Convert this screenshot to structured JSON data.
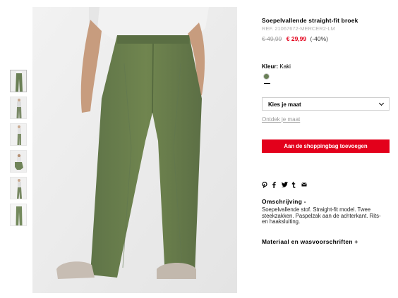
{
  "product": {
    "title": "Soepelvallende straight-fit broek",
    "ref": "REF. 21067672-MERCER2-LM",
    "old_price": "€ 49,99",
    "new_price": "€ 29,99",
    "discount": "(-40%)"
  },
  "color": {
    "label": "Kleur:",
    "value": "Kaki",
    "swatch_color": "#6a8057"
  },
  "size": {
    "select_label": "Kies je maat",
    "link": "Ontdek je maat"
  },
  "cta": {
    "add_to_bag": "Aan de shoppingbag toevoegen",
    "color": "#e3001b"
  },
  "share_icons": [
    "pinterest-icon",
    "facebook-icon",
    "twitter-icon",
    "tumblr-icon",
    "email-icon"
  ],
  "description": {
    "title": "Omschrijving -",
    "text": "Soepelvallende stof. Straight-fit model. Twee steekzakken. Paspelzak aan de achterkant. Rits- en haaksluiting."
  },
  "material": {
    "title": "Materiaal en wasvoorschriften +"
  }
}
